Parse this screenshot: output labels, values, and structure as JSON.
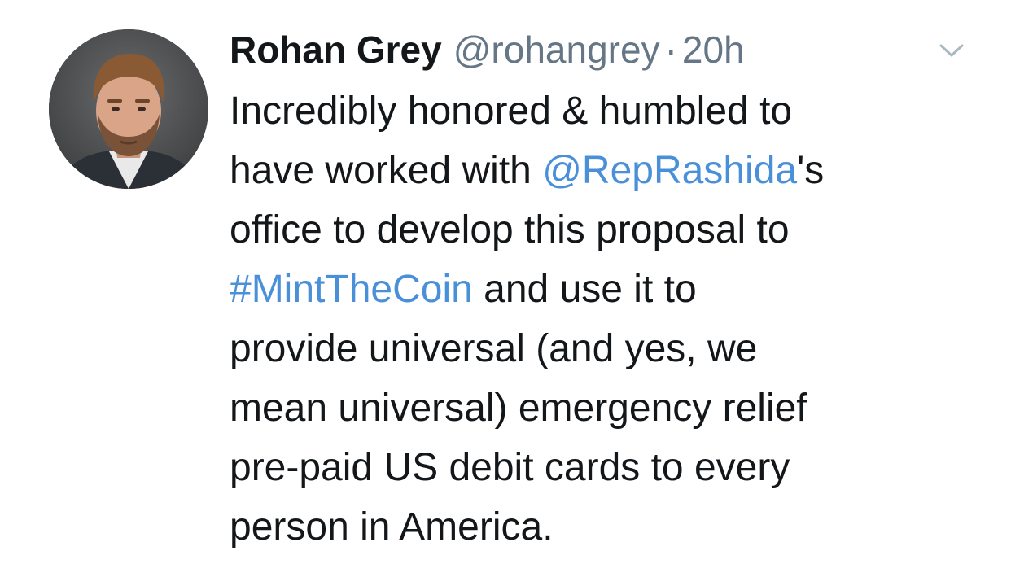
{
  "author": {
    "display_name": "Rohan Grey",
    "handle": "@rohangrey",
    "separator": "·",
    "timestamp": "20h",
    "avatar_icon": "profile-photo"
  },
  "menu": {
    "icon": "chevron-down-icon",
    "color": "#aab8c2"
  },
  "tweet": {
    "line1": "Incredibly honored & humbled to",
    "line2_before": "have worked with ",
    "mention": "@RepRashida",
    "line2_after": "'s",
    "line3": "office to develop this proposal to",
    "hashtag": "#MintTheCoin",
    "line4_after": " and use it to",
    "line5": "provide universal (and yes, we",
    "line6": "mean universal) emergency relief",
    "line7": "pre-paid US debit cards to every",
    "line8": "person in America."
  },
  "colors": {
    "text": "#14171a",
    "secondary": "#657786",
    "link": "#4a90d9"
  }
}
